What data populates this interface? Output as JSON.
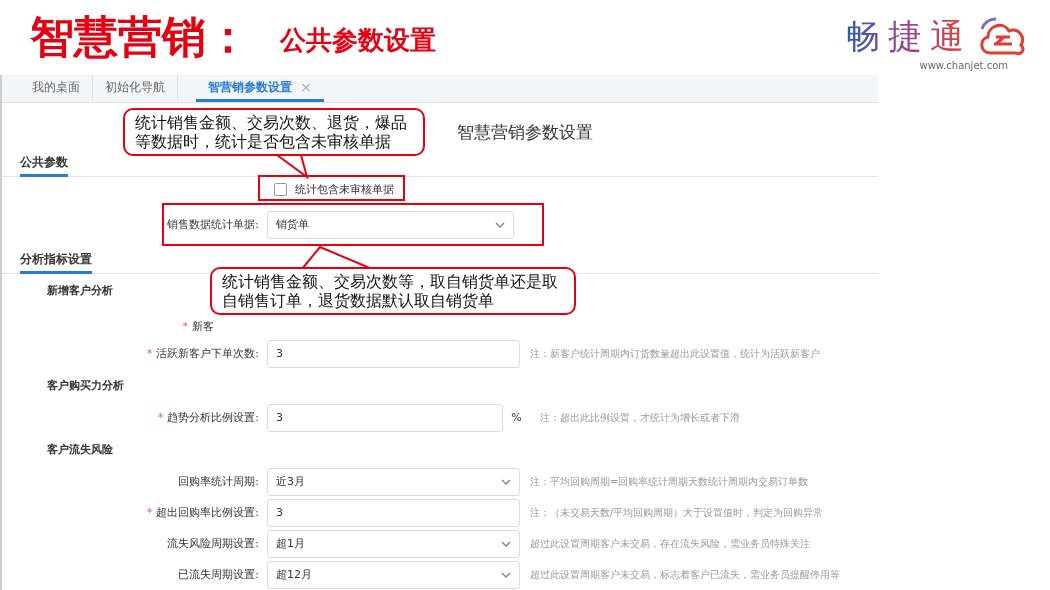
{
  "slide": {
    "title": "智慧营销：",
    "subtitle": "公共参数设置",
    "logo": {
      "name": "畅捷通",
      "url": "www.chanjet.com"
    }
  },
  "tabs": [
    {
      "label": "我的桌面",
      "selected": false
    },
    {
      "label": "初始化导航",
      "selected": false
    },
    {
      "label": "智营销参数设置",
      "selected": true,
      "close": "×"
    }
  ],
  "page_title": "智慧营销参数设置",
  "public_section": {
    "title": "公共参数",
    "checkbox": {
      "label": "统计包含未审核单据",
      "checked": false
    },
    "select": {
      "label": "销售数据统计单据:",
      "value": "销货单"
    }
  },
  "analysis_section": {
    "title": "分析指标设置",
    "groups": [
      {
        "title": "新增客户分析",
        "rows": [
          {
            "kind": "covered",
            "mark": "*",
            "label": "新客"
          },
          {
            "kind": "input",
            "mark": "*",
            "label": "活跃新客户下单次数:",
            "value": "3",
            "note": "注：新客户统计周期内订货数量超出此设置值，统计为活跃新客户"
          }
        ]
      },
      {
        "title": "客户购买力分析",
        "rows": [
          {
            "kind": "input",
            "mark": "*",
            "label": "趋势分析比例设置:",
            "value": "3",
            "unit": "%",
            "note": "注：超出此比例设置，才统计为增长或者下滑"
          }
        ]
      },
      {
        "title": "客户流失风险",
        "rows": [
          {
            "kind": "select",
            "label": "回购率统计周期:",
            "value": "近3月",
            "note": "注：平均回购周期=回购率统计周期天数统计周期内交易订单数"
          },
          {
            "kind": "input",
            "mark": "*",
            "label": "超出回购率比例设置:",
            "value": "3",
            "note": "注：（未交易天数/平均回购周期）大于设置值时，判定为回购异常"
          },
          {
            "kind": "select",
            "label": "流失风险周期设置:",
            "value": "超1月",
            "note": "超过此设置周期客户未交易，存在流失风险，需业务员特殊关注"
          },
          {
            "kind": "select",
            "label": "已流失周期设置:",
            "value": "超12月",
            "note": "超过此设置周期客户未交易，标志着客户已流失，需业务员提醒停用等"
          }
        ]
      }
    ]
  },
  "callouts": [
    {
      "text": "统计销售金额、交易次数、退货，爆品等数据时，统计是否包含未审核单据"
    },
    {
      "text": "统计销售金额、交易次数等，取自销货单还是取自销售订单，退货数据默认取自销货单"
    }
  ]
}
